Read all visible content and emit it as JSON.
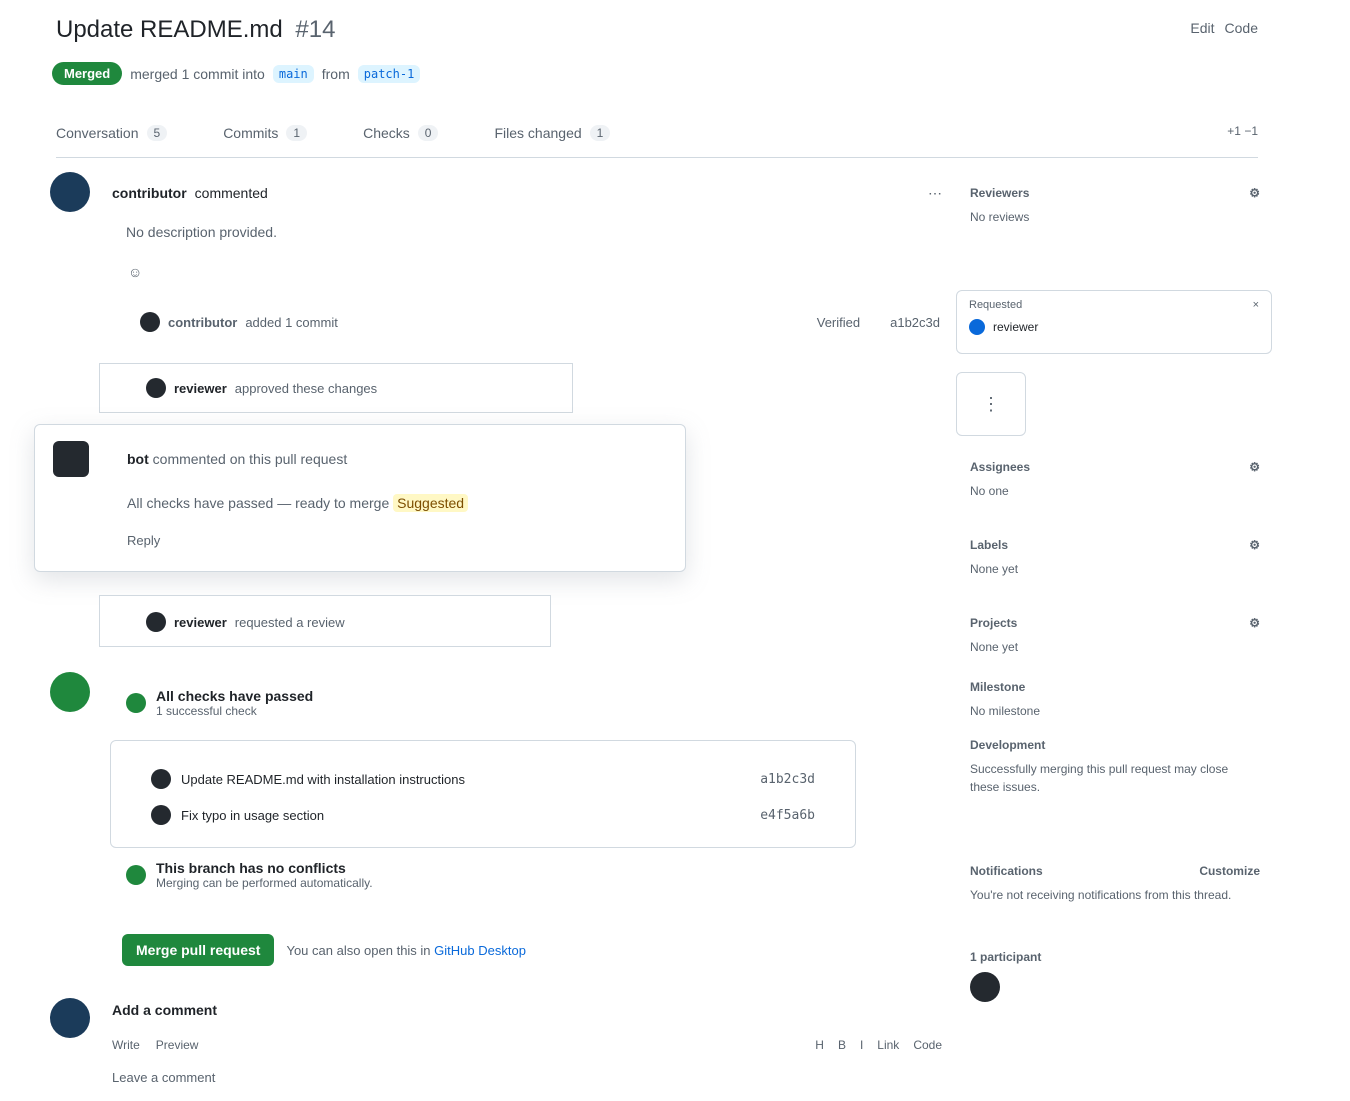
{
  "header": {
    "title": "Update README.md",
    "number": "#14",
    "status": "Merged",
    "summary": "merged 1 commit into",
    "base_branch": "main",
    "from_text": "from",
    "head_branch": "patch-1",
    "edit_label": "Edit",
    "code_label": "Code"
  },
  "tabs": [
    {
      "label": "Conversation",
      "count": "5"
    },
    {
      "label": "Commits",
      "count": "1"
    },
    {
      "label": "Checks",
      "count": "0"
    },
    {
      "label": "Files changed",
      "count": "1"
    }
  ],
  "diffstat": "+1 −1",
  "first_comment": {
    "author": "contributor",
    "text": "commented",
    "body": "No description provided.",
    "reaction": "☺"
  },
  "thread": {
    "author": "contributor",
    "action": "added 1 commit",
    "sha": "a1b2c3d",
    "verified": "Verified"
  },
  "card1": {
    "author": "reviewer",
    "text": "approved these changes"
  },
  "popover": {
    "author": "bot",
    "action": "commented on this pull request",
    "line": "All checks have passed — ready to merge",
    "badge": "Suggested",
    "footer": "Reply"
  },
  "card2": {
    "author": "reviewer",
    "text": "requested a review"
  },
  "checks": {
    "title": "All checks have passed",
    "subtitle": "1 successful check",
    "second_title": "This branch has no conflicts",
    "second_sub": "Merging can be performed automatically."
  },
  "commits": [
    {
      "msg": "Update README.md with installation instructions",
      "sha": "a1b2c3d"
    },
    {
      "msg": "Fix typo in usage section",
      "sha": "e4f5a6b"
    }
  ],
  "merge": {
    "button": "Merge pull request",
    "note": "You can also open this in",
    "link": "GitHub Desktop"
  },
  "bottom": {
    "author": "Add a comment",
    "tools": [
      "Write",
      "Preview"
    ],
    "tools_right": [
      "H",
      "B",
      "I",
      "Link",
      "Code"
    ],
    "placeholder": "Leave a comment"
  },
  "sidebar": {
    "reviewers_label": "Reviewers",
    "reviewers_value": "No reviews",
    "reviewer_card_label": "Requested",
    "reviewer_name": "reviewer",
    "assignees_label": "Assignees",
    "assignees_value": "No one",
    "labels_label": "Labels",
    "labels_value": "None yet",
    "projects_label": "Projects",
    "projects_value": "None yet",
    "milestone_label": "Milestone",
    "milestone_value": "No milestone",
    "development_label": "Development",
    "development_value": "Successfully merging this pull request may close these issues.",
    "notifications_label": "Notifications",
    "notifications_action": "Customize",
    "notifications_value": "You're not receiving notifications from this thread.",
    "participants_label": "1 participant"
  },
  "colors": {
    "accent": "#1f883d",
    "link": "#0969da"
  }
}
